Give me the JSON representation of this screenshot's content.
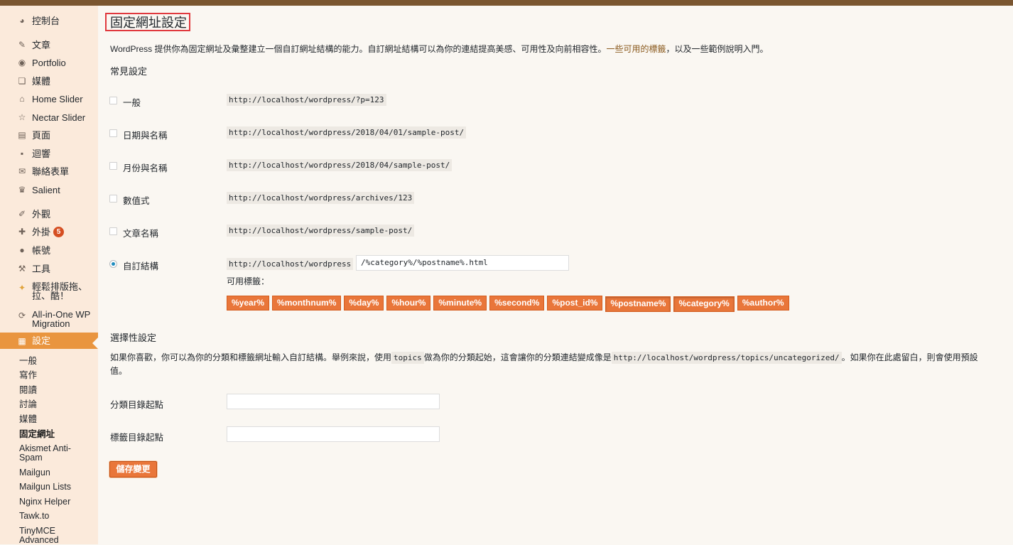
{
  "colors": {
    "accent": "#e9953f",
    "tag_bg": "#e9763a",
    "topbar": "#7a5630",
    "sidebar_bg": "#fbeadb",
    "title_outline": "#e0393e"
  },
  "sidebar": {
    "items": [
      {
        "label": "控制台",
        "icon": "dashboard-icon"
      },
      {
        "label": "文章",
        "icon": "pin-icon"
      },
      {
        "label": "Portfolio",
        "icon": "palette-icon"
      },
      {
        "label": "媒體",
        "icon": "media-icon"
      },
      {
        "label": "Home Slider",
        "icon": "home-icon"
      },
      {
        "label": "Nectar Slider",
        "icon": "star-icon"
      },
      {
        "label": "頁面",
        "icon": "page-icon"
      },
      {
        "label": "迴響",
        "icon": "comment-icon"
      },
      {
        "label": "聯絡表單",
        "icon": "mail-icon"
      },
      {
        "label": "Salient",
        "icon": "crown-icon"
      },
      {
        "label": "外觀",
        "icon": "brush-icon"
      },
      {
        "label": "外掛",
        "icon": "plugin-icon",
        "badge": "5"
      },
      {
        "label": "帳號",
        "icon": "user-icon"
      },
      {
        "label": "工具",
        "icon": "wrench-icon"
      },
      {
        "label": "輕鬆排版拖、拉、酷！",
        "icon": "layout-icon"
      },
      {
        "label": "All-in-One WP Migration",
        "icon": "migration-icon"
      },
      {
        "label": "設定",
        "icon": "settings-icon"
      }
    ],
    "submenu": [
      "一般",
      "寫作",
      "閱讀",
      "討論",
      "媒體",
      "固定網址",
      "Akismet Anti-Spam",
      "Mailgun",
      "Mailgun Lists",
      "Nginx Helper",
      "Tawk.to",
      "TinyMCE Advanced"
    ]
  },
  "page": {
    "title": "固定網址設定",
    "intro_text": "WordPress 提供你為固定網址及彙整建立一個自訂網址結構的能力。自訂網址結構可以為你的連結提高美感、可用性及向前相容性。",
    "intro_link": "一些可用的標籤",
    "intro_tail": "，以及一些範例說明入門。",
    "common_heading": "常見設定",
    "options": [
      {
        "label": "一般",
        "example": "http://localhost/wordpress/?p=123"
      },
      {
        "label": "日期與名稱",
        "example": "http://localhost/wordpress/2018/04/01/sample-post/"
      },
      {
        "label": "月份與名稱",
        "example": "http://localhost/wordpress/2018/04/sample-post/"
      },
      {
        "label": "數值式",
        "example": "http://localhost/wordpress/archives/123"
      },
      {
        "label": "文章名稱",
        "example": "http://localhost/wordpress/sample-post/"
      }
    ],
    "custom": {
      "label": "自訂結構",
      "prefix": "http://localhost/wordpress",
      "value": "/%category%/%postname%.html",
      "available_label": "可用標籤：",
      "tags": [
        "%year%",
        "%monthnum%",
        "%day%",
        "%hour%",
        "%minute%",
        "%second%",
        "%post_id%",
        "%postname%",
        "%category%",
        "%author%"
      ]
    },
    "optional_heading": "選擇性設定",
    "optional_pre": "如果你喜歡，你可以為你的分類和標籤網址輸入自訂結構。舉例來說，使用",
    "optional_code1": "topics",
    "optional_mid": "做為你的分類起始，這會讓你的分類連結變成像是",
    "optional_code2": "http://localhost/wordpress/topics/uncategorized/",
    "optional_post": "。如果你在此處留白，則會使用預設值。",
    "category_base_label": "分類目錄起點",
    "category_base_value": "",
    "tag_base_label": "標籤目錄起點",
    "tag_base_value": "",
    "save_label": "儲存變更"
  }
}
